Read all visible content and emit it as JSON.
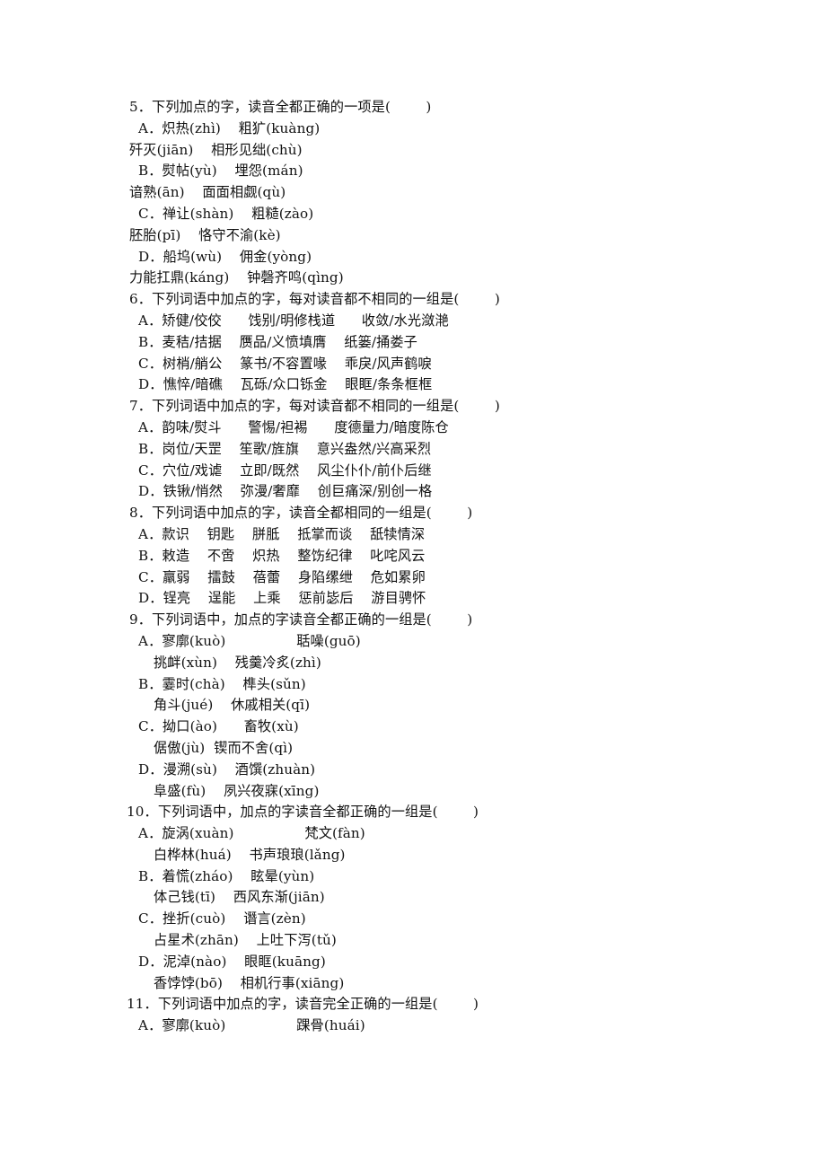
{
  "document": {
    "kind": "chinese-language-exam-worksheet",
    "page_background": "#ffffff",
    "text_color": "#111111"
  },
  "questions": [
    {
      "number": "5",
      "stem": "5．下列加点的字，读音全都正确的一项是(        )",
      "lines": [
        {
          "type": "option",
          "text": "A．炽热(zhì)    粗犷(kuàng)"
        },
        {
          "type": "cont",
          "text": "歼灭(jiān)    相形见绌(chù)"
        },
        {
          "type": "option",
          "text": "B．熨帖(yù)    埋怨(mán)"
        },
        {
          "type": "cont",
          "text": "谙熟(ān)    面面相觑(qù)"
        },
        {
          "type": "option",
          "text": "C．禅让(shàn)    粗糙(zào)"
        },
        {
          "type": "cont",
          "text": "胚胎(pī)    恪守不渝(kè)"
        },
        {
          "type": "option",
          "text": "D．船坞(wù)    佣金(yòng)"
        },
        {
          "type": "cont",
          "text": "力能扛鼎(káng)    钟磬齐鸣(qìng)"
        }
      ]
    },
    {
      "number": "6",
      "stem": "6．下列词语中加点的字，每对读音都不相同的一组是(        )",
      "lines": [
        {
          "type": "option",
          "text": "A．矫健/佼佼      饯别/明修栈道      收敛/水光潋滟"
        },
        {
          "type": "option",
          "text": "B．麦秸/拮据    赝品/义愤填膺    纸篓/捅娄子"
        },
        {
          "type": "option",
          "text": "C．树梢/艄公    篆书/不容置喙    乖戾/风声鹤唳"
        },
        {
          "type": "option",
          "text": "D．憔悴/暗礁    瓦砾/众口铄金    眼眶/条条框框"
        }
      ]
    },
    {
      "number": "7",
      "stem": "7．下列词语中加点的字，每对读音都不相同的一组是(        )",
      "lines": [
        {
          "type": "option",
          "text": "A．韵味/熨斗      警惕/袒裼      度德量力/暗度陈仓"
        },
        {
          "type": "option",
          "text": "B．岗位/天罡    笙歌/旌旗    意兴盎然/兴高采烈"
        },
        {
          "type": "option",
          "text": "C．穴位/戏谑    立即/既然    风尘仆仆/前仆后继"
        },
        {
          "type": "option",
          "text": "D．铁锹/悄然    弥漫/奢靡    创巨痛深/别创一格"
        }
      ]
    },
    {
      "number": "8",
      "stem": "8．下列词语中加点的字，读音全都相同的一组是(        )",
      "lines": [
        {
          "type": "option",
          "text": "A．款识    钥匙    胼胝    抵掌而谈    舐犊情深"
        },
        {
          "type": "option",
          "text": "B．敕造    不啻    炽热    整饬纪律    叱咤风云"
        },
        {
          "type": "option",
          "text": "C．羸弱    擂鼓    蓓蕾    身陷缧绁    危如累卵"
        },
        {
          "type": "option",
          "text": "D．锃亮    逞能    上乘    惩前毖后    游目骋怀"
        }
      ]
    },
    {
      "number": "9",
      "stem": "9．下列词语中，加点的字读音全都正确的一组是(        )",
      "lines": [
        {
          "type": "option",
          "text": "A．寥廓(kuò)                聒噪(guō)"
        },
        {
          "type": "cont-indent",
          "text": "挑衅(xùn)    残羹冷炙(zhì)"
        },
        {
          "type": "option",
          "text": "B．霎时(chà)    榫头(sǔn)"
        },
        {
          "type": "cont-indent",
          "text": "角斗(jué)    休戚相关(qī)"
        },
        {
          "type": "option",
          "text": "C．拗口(ào)      畜牧(xù)"
        },
        {
          "type": "cont-indent",
          "text": "倨傲(jù)  锲而不舍(qì)"
        },
        {
          "type": "option",
          "text": "D．漫溯(sù)    酒馔(zhuàn)"
        },
        {
          "type": "cont-indent",
          "text": "阜盛(fù)    夙兴夜寐(xīng)"
        }
      ]
    },
    {
      "number": "10",
      "stem": "10．下列词语中，加点的字读音全都正确的一组是(        )",
      "lines": [
        {
          "type": "option",
          "text": "A．旋涡(xuàn)                梵文(fàn)"
        },
        {
          "type": "cont-indent",
          "text": "白桦林(huá)    书声琅琅(lǎng)"
        },
        {
          "type": "option",
          "text": "B．着慌(zháo)    眩晕(yùn)"
        },
        {
          "type": "cont-indent",
          "text": "体己钱(tī)    西风东渐(jiān)"
        },
        {
          "type": "option",
          "text": "C．挫折(cuò)    谮言(zèn)"
        },
        {
          "type": "cont-indent",
          "text": "占星术(zhān)    上吐下泻(tǔ)"
        },
        {
          "type": "option",
          "text": "D．泥淖(nào)    眼眶(kuāng)"
        },
        {
          "type": "cont-indent",
          "text": "香饽饽(bō)    相机行事(xiāng)"
        }
      ]
    },
    {
      "number": "11",
      "stem": "11．下列词语中加点的字，读音完全正确的一组是(        )",
      "lines": [
        {
          "type": "option",
          "text": "A．寥廓(kuò)                踝骨(huái)"
        }
      ]
    }
  ]
}
